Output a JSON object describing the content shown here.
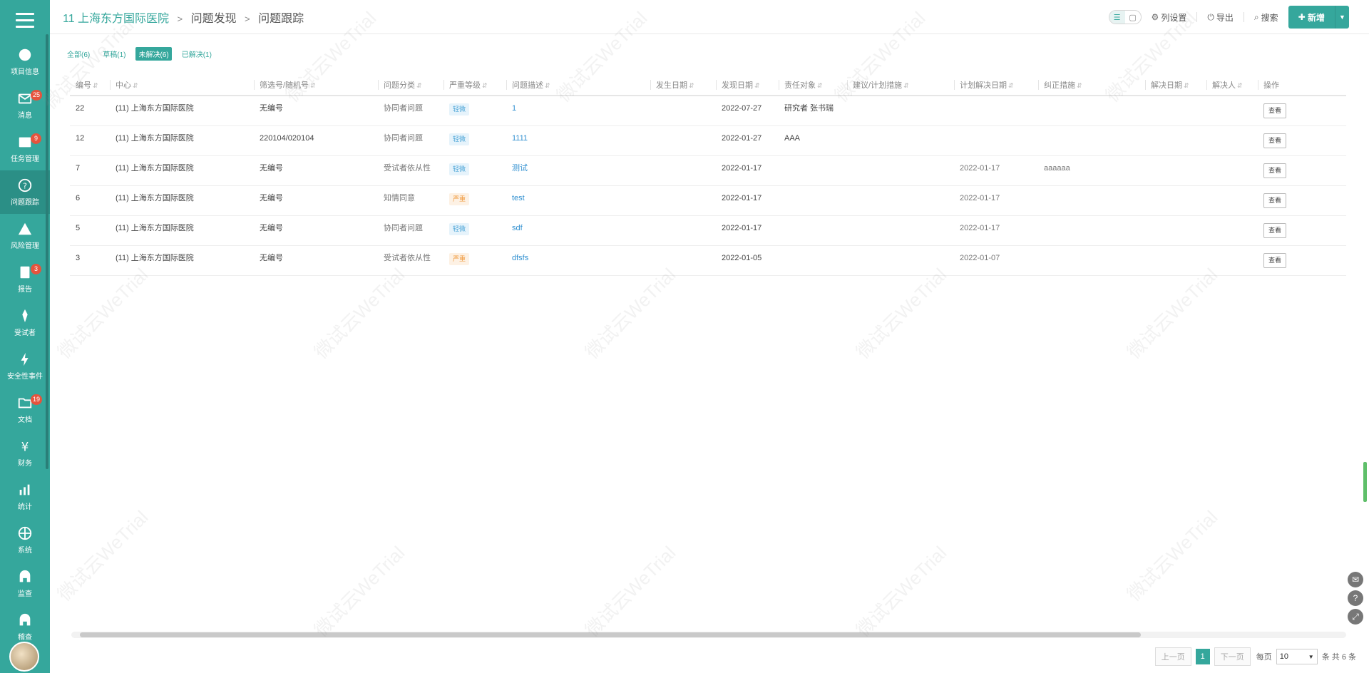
{
  "sidebar": {
    "items": [
      {
        "icon": "pie-chart-icon",
        "label": "项目信息",
        "badge": ""
      },
      {
        "icon": "mail-icon",
        "label": "消息",
        "badge": "25"
      },
      {
        "icon": "calendar-icon",
        "label": "任务管理",
        "badge": "9"
      },
      {
        "icon": "question-icon",
        "label": "问题跟踪",
        "badge": "",
        "active": true
      },
      {
        "icon": "warning-icon",
        "label": "风险管理",
        "badge": ""
      },
      {
        "icon": "report-icon",
        "label": "报告",
        "badge": "3"
      },
      {
        "icon": "flask-icon",
        "label": "受试者",
        "badge": ""
      },
      {
        "icon": "lightning-icon",
        "label": "安全性事件",
        "badge": ""
      },
      {
        "icon": "folder-icon",
        "label": "文档",
        "badge": "19"
      },
      {
        "icon": "yen-icon",
        "label": "财务",
        "badge": ""
      },
      {
        "icon": "stats-icon",
        "label": "统计",
        "badge": ""
      },
      {
        "icon": "globe-icon",
        "label": "系统",
        "badge": ""
      },
      {
        "icon": "arch-icon",
        "label": "监查",
        "badge": ""
      },
      {
        "icon": "arch2-icon",
        "label": "稽查",
        "badge": ""
      }
    ]
  },
  "breadcrumb": {
    "root": "11 上海东方国际医院",
    "level1": "问题发现",
    "level2": "问题跟踪",
    "sep": ">"
  },
  "header_actions": {
    "columns": "列设置",
    "export": "导出",
    "search": "搜索",
    "new": "新增"
  },
  "filters": [
    {
      "label": "全部(6)",
      "active": false
    },
    {
      "label": "草稿(1)",
      "active": false
    },
    {
      "label": "未解决(6)",
      "active": true
    },
    {
      "label": "已解决(1)",
      "active": false
    }
  ],
  "table": {
    "columns": [
      "编号",
      "中心",
      "筛选号/随机号",
      "问题分类",
      "严重等级",
      "问题描述",
      "发生日期",
      "发现日期",
      "责任对象",
      "建议/计划措施",
      "计划解决日期",
      "纠正措施",
      "解决日期",
      "解决人",
      "操作"
    ],
    "rows": [
      {
        "id": "22",
        "center": "(11) 上海东方国际医院",
        "screen_no": "无编号",
        "category": "协同者问题",
        "severity": "轻微",
        "sev_type": "minor",
        "desc": "1",
        "occur": "",
        "found": "2022-07-27",
        "owner": "研究者 张书瑞",
        "plan": "",
        "plan_date": "",
        "corrective": "",
        "solve_date": "",
        "solver": "",
        "action": "查看"
      },
      {
        "id": "12",
        "center": "(11) 上海东方国际医院",
        "screen_no": "220104/020104",
        "category": "协同者问题",
        "severity": "轻微",
        "sev_type": "minor",
        "desc": "1111",
        "occur": "",
        "found": "2022-01-27",
        "owner": "AAA",
        "plan": "",
        "plan_date": "",
        "corrective": "",
        "solve_date": "",
        "solver": "",
        "action": "查看"
      },
      {
        "id": "7",
        "center": "(11) 上海东方国际医院",
        "screen_no": "无编号",
        "category": "受试者依从性",
        "severity": "轻微",
        "sev_type": "minor",
        "desc": "测试",
        "occur": "",
        "found": "2022-01-17",
        "owner": "",
        "plan": "",
        "plan_date": "2022-01-17",
        "corrective": "aaaaaa",
        "solve_date": "",
        "solver": "",
        "action": "查看"
      },
      {
        "id": "6",
        "center": "(11) 上海东方国际医院",
        "screen_no": "无编号",
        "category": "知情同意",
        "severity": "严重",
        "sev_type": "major",
        "desc": "test",
        "occur": "",
        "found": "2022-01-17",
        "owner": "",
        "plan": "",
        "plan_date": "2022-01-17",
        "corrective": "",
        "solve_date": "",
        "solver": "",
        "action": "查看"
      },
      {
        "id": "5",
        "center": "(11) 上海东方国际医院",
        "screen_no": "无编号",
        "category": "协同者问题",
        "severity": "轻微",
        "sev_type": "minor",
        "desc": "sdf",
        "occur": "",
        "found": "2022-01-17",
        "owner": "",
        "plan": "",
        "plan_date": "2022-01-17",
        "corrective": "",
        "solve_date": "",
        "solver": "",
        "action": "查看"
      },
      {
        "id": "3",
        "center": "(11) 上海东方国际医院",
        "screen_no": "无编号",
        "category": "受试者依从性",
        "severity": "严重",
        "sev_type": "major",
        "desc": "dfsfs",
        "occur": "",
        "found": "2022-01-05",
        "owner": "",
        "plan": "",
        "plan_date": "2022-01-07",
        "corrective": "",
        "solve_date": "",
        "solver": "",
        "action": "查看"
      }
    ]
  },
  "pagination": {
    "prev": "上一页",
    "page": "1",
    "next": "下一页",
    "per_page_label": "每页",
    "per_page": "10",
    "total": "条 共 6 条"
  },
  "watermark": "微试云WeTrial",
  "colors": {
    "accent": "#35a79c",
    "minor_tag": "#4ea6d8",
    "major_tag": "#f09a3e"
  }
}
